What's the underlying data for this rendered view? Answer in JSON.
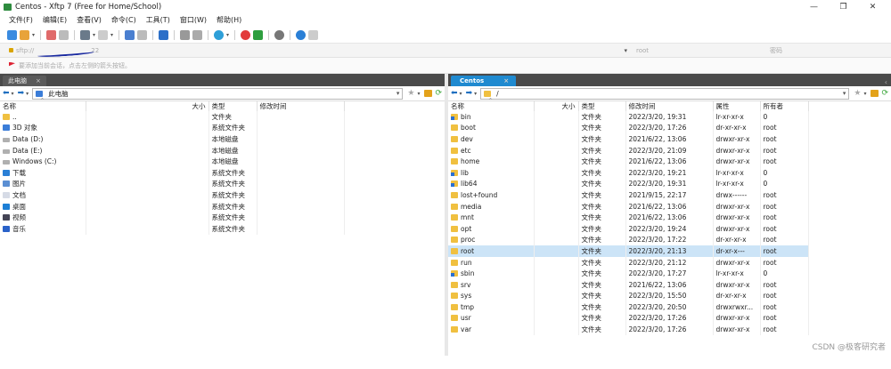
{
  "window": {
    "title": "Centos - Xftp 7 (Free for Home/School)",
    "minimize": "—",
    "maximize": "❐",
    "close": "✕"
  },
  "menu": [
    "文件(F)",
    "编辑(E)",
    "查看(V)",
    "命令(C)",
    "工具(T)",
    "窗口(W)",
    "帮助(H)"
  ],
  "address": {
    "host": "sftp://",
    "host_tail": "22",
    "user": "root",
    "password": "密码"
  },
  "hint": "要添加当前会话，点击左侧的箭头按钮。",
  "left": {
    "tab": "此电脑",
    "path": "此电脑",
    "columns": [
      "名称",
      "大小",
      "类型",
      "修改时间"
    ],
    "rows": [
      {
        "name": "..",
        "size": "",
        "type": "文件夹",
        "icon": "folder"
      },
      {
        "name": "3D 对象",
        "size": "",
        "type": "系统文件夹",
        "icon": "blue"
      },
      {
        "name": "Data (D:)",
        "size": "",
        "type": "本地磁盘",
        "icon": "drive"
      },
      {
        "name": "Data (E:)",
        "size": "",
        "type": "本地磁盘",
        "icon": "drive"
      },
      {
        "name": "Windows (C:)",
        "size": "",
        "type": "本地磁盘",
        "icon": "drive"
      },
      {
        "name": "下载",
        "size": "",
        "type": "系统文件夹",
        "icon": "dl"
      },
      {
        "name": "图片",
        "size": "",
        "type": "系统文件夹",
        "icon": "pic"
      },
      {
        "name": "文档",
        "size": "",
        "type": "系统文件夹",
        "icon": "doc"
      },
      {
        "name": "桌面",
        "size": "",
        "type": "系统文件夹",
        "icon": "desk"
      },
      {
        "name": "视频",
        "size": "",
        "type": "系统文件夹",
        "icon": "vid"
      },
      {
        "name": "音乐",
        "size": "",
        "type": "系统文件夹",
        "icon": "mus"
      }
    ]
  },
  "right": {
    "tab": "Centos",
    "path": "/",
    "columns": [
      "名称",
      "大小",
      "类型",
      "修改时间",
      "属性",
      "所有者"
    ],
    "rows": [
      {
        "name": "bin",
        "type": "文件夹",
        "mtime": "2022/3/20, 19:31",
        "attr": "lr-xr-xr-x",
        "owner": "0",
        "icon": "link"
      },
      {
        "name": "boot",
        "type": "文件夹",
        "mtime": "2022/3/20, 17:26",
        "attr": "dr-xr-xr-x",
        "owner": "root",
        "icon": "folder"
      },
      {
        "name": "dev",
        "type": "文件夹",
        "mtime": "2021/6/22, 13:06",
        "attr": "drwxr-xr-x",
        "owner": "root",
        "icon": "folder"
      },
      {
        "name": "etc",
        "type": "文件夹",
        "mtime": "2022/3/20, 21:09",
        "attr": "drwxr-xr-x",
        "owner": "root",
        "icon": "folder"
      },
      {
        "name": "home",
        "type": "文件夹",
        "mtime": "2021/6/22, 13:06",
        "attr": "drwxr-xr-x",
        "owner": "root",
        "icon": "folder"
      },
      {
        "name": "lib",
        "type": "文件夹",
        "mtime": "2022/3/20, 19:21",
        "attr": "lr-xr-xr-x",
        "owner": "0",
        "icon": "link"
      },
      {
        "name": "lib64",
        "type": "文件夹",
        "mtime": "2022/3/20, 19:31",
        "attr": "lr-xr-xr-x",
        "owner": "0",
        "icon": "link"
      },
      {
        "name": "lost+found",
        "type": "文件夹",
        "mtime": "2021/9/15, 22:17",
        "attr": "drwx------",
        "owner": "root",
        "icon": "folder"
      },
      {
        "name": "media",
        "type": "文件夹",
        "mtime": "2021/6/22, 13:06",
        "attr": "drwxr-xr-x",
        "owner": "root",
        "icon": "folder"
      },
      {
        "name": "mnt",
        "type": "文件夹",
        "mtime": "2021/6/22, 13:06",
        "attr": "drwxr-xr-x",
        "owner": "root",
        "icon": "folder"
      },
      {
        "name": "opt",
        "type": "文件夹",
        "mtime": "2022/3/20, 19:24",
        "attr": "drwxr-xr-x",
        "owner": "root",
        "icon": "folder"
      },
      {
        "name": "proc",
        "type": "文件夹",
        "mtime": "2022/3/20, 17:22",
        "attr": "dr-xr-xr-x",
        "owner": "root",
        "icon": "folder"
      },
      {
        "name": "root",
        "type": "文件夹",
        "mtime": "2022/3/20, 21:13",
        "attr": "dr-xr-x---",
        "owner": "root",
        "icon": "folder",
        "selected": true
      },
      {
        "name": "run",
        "type": "文件夹",
        "mtime": "2022/3/20, 21:12",
        "attr": "drwxr-xr-x",
        "owner": "root",
        "icon": "folder"
      },
      {
        "name": "sbin",
        "type": "文件夹",
        "mtime": "2022/3/20, 17:27",
        "attr": "lr-xr-xr-x",
        "owner": "0",
        "icon": "link"
      },
      {
        "name": "srv",
        "type": "文件夹",
        "mtime": "2021/6/22, 13:06",
        "attr": "drwxr-xr-x",
        "owner": "root",
        "icon": "folder"
      },
      {
        "name": "sys",
        "type": "文件夹",
        "mtime": "2022/3/20, 15:50",
        "attr": "dr-xr-xr-x",
        "owner": "root",
        "icon": "folder"
      },
      {
        "name": "tmp",
        "type": "文件夹",
        "mtime": "2022/3/20, 20:50",
        "attr": "drwxrwxr...",
        "owner": "root",
        "icon": "folder"
      },
      {
        "name": "usr",
        "type": "文件夹",
        "mtime": "2022/3/20, 17:26",
        "attr": "drwxr-xr-x",
        "owner": "root",
        "icon": "folder"
      },
      {
        "name": "var",
        "type": "文件夹",
        "mtime": "2022/3/20, 17:26",
        "attr": "drwxr-xr-x",
        "owner": "root",
        "icon": "folder"
      }
    ]
  },
  "watermark": "CSDN @极客研究者"
}
